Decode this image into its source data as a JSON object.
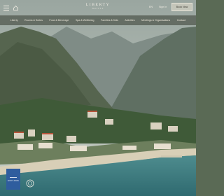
{
  "header": {
    "brand": "LIBERTY",
    "brand_sub": "HOTELS",
    "language": "EN",
    "login": "Sign In",
    "book_button": "Book Now"
  },
  "nav": {
    "items": [
      {
        "label": "Liberty"
      },
      {
        "label": "Rooms & Suites"
      },
      {
        "label": "Food & Beverage"
      },
      {
        "label": "Spa & Wellbeing"
      },
      {
        "label": "Families & Kids"
      },
      {
        "label": "Activities"
      },
      {
        "label": "Meetings & Organisations"
      },
      {
        "label": "Contact"
      }
    ]
  },
  "promo": {
    "label": "EXPLORE"
  },
  "icons": {
    "menu": "hamburger-menu-icon",
    "home": "home-icon",
    "badge": "award-badge-icon"
  },
  "colors": {
    "nav_bar": "#343a30",
    "promo": "#2f5d9e",
    "text_light": "#efe9dc"
  }
}
